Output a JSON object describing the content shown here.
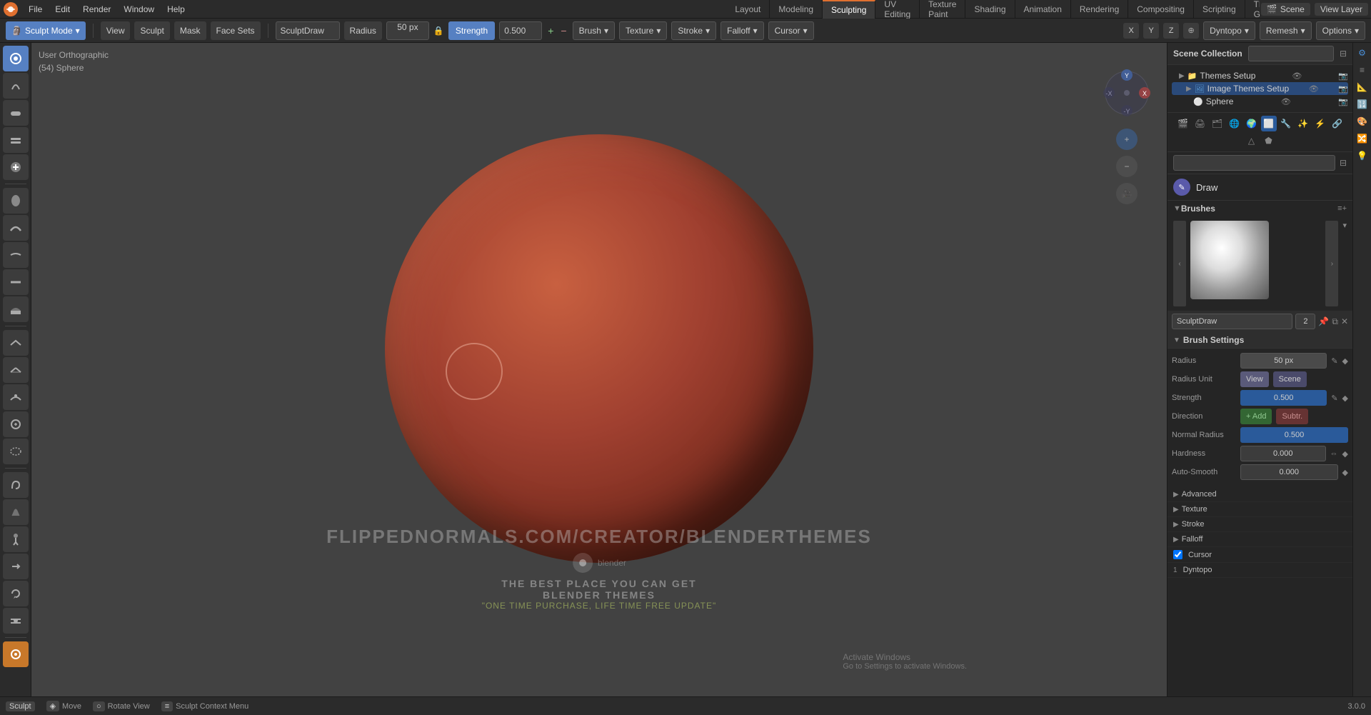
{
  "app": {
    "title": "Blender",
    "version": "3.0.0"
  },
  "top_menu": {
    "items": [
      "File",
      "Edit",
      "Render",
      "Window",
      "Help"
    ],
    "tabs": [
      "Layout",
      "Modeling",
      "Sculpting",
      "UV Editing",
      "Texture Paint",
      "Shading",
      "Animation",
      "Rendering",
      "Compositing",
      "Scripting",
      "Themes Generator"
    ],
    "active_tab": "Sculpting",
    "plus_label": "+",
    "view_layer": "View Layer",
    "scene": "Scene"
  },
  "toolbar": {
    "mode": "Sculpt Mode",
    "view_label": "View",
    "sculpt_label": "Sculpt",
    "mask_label": "Mask",
    "face_sets_label": "Face Sets",
    "brush_name": "SculptDraw",
    "radius_label": "Radius",
    "radius_value": "50 px",
    "strength_label": "Strength",
    "strength_value": "0.500",
    "brush_label": "Brush",
    "texture_label": "Texture",
    "stroke_label": "Stroke",
    "falloff_label": "Falloff",
    "cursor_label": "Cursor",
    "axes": [
      "X",
      "Y",
      "Z"
    ],
    "dyntopo_label": "Dyntopo",
    "remesh_label": "Remesh",
    "options_label": "Options"
  },
  "viewport": {
    "view_info": "User Orthographic",
    "object_info": "(54) Sphere",
    "watermark_url": "FLIPPEDNORMALS.COM/CREATOR/BLENDERTHEMES",
    "watermark_line1": "THE BEST PLACE YOU CAN GET",
    "watermark_line2": "BLENDER THEMES",
    "watermark_tagline": "\"ONE TIME PURCHASE, LIFE TIME FREE UPDATE\""
  },
  "outliner": {
    "title": "Scene Collection",
    "search_placeholder": "",
    "items": [
      {
        "label": "Themes Setup",
        "icon": "📁",
        "level": 0,
        "has_eye": true
      },
      {
        "label": "Image Themes Setup",
        "icon": "🖼",
        "level": 1,
        "selected": true,
        "has_eye": true
      },
      {
        "label": "Sphere",
        "icon": "⚪",
        "level": 2,
        "has_eye": true
      }
    ]
  },
  "properties": {
    "draw_label": "Draw",
    "brushes_title": "Brushes",
    "brush_name": "SculptDraw",
    "brush_num": "2",
    "brush_settings_title": "Brush Settings",
    "radius_label": "Radius",
    "radius_value": "50 px",
    "radius_unit_label": "Radius Unit",
    "radius_unit_view": "View",
    "radius_unit_scene": "Scene",
    "strength_label": "Strength",
    "strength_value": "0.500",
    "direction_label": "Direction",
    "direction_add": "Add",
    "direction_sub": "Subtr.",
    "normal_radius_label": "Normal Radius",
    "normal_radius_value": "0.500",
    "hardness_label": "Hardness",
    "hardness_value": "0.000",
    "auto_smooth_label": "Auto-Smooth",
    "auto_smooth_value": "0.000",
    "sections": [
      {
        "label": "Advanced",
        "expanded": false
      },
      {
        "label": "Texture",
        "expanded": false
      },
      {
        "label": "Stroke",
        "expanded": false
      },
      {
        "label": "Falloff",
        "expanded": false
      },
      {
        "label": "Cursor",
        "checked": true
      },
      {
        "label": "Dyntopo",
        "expanded": false
      }
    ]
  },
  "status_bar": {
    "items": [
      {
        "key": "Sculpt",
        "desc": ""
      },
      {
        "key": "Move",
        "icon": "◈"
      },
      {
        "key": "Rotate View",
        "icon": "○"
      },
      {
        "key": "Sculpt Context Menu",
        "icon": "≡"
      }
    ],
    "version": "3.0.0",
    "activate_windows": "Activate Windows",
    "go_to_settings": "Go to Settings to activate Windows."
  },
  "colors": {
    "accent": "#4a90d9",
    "sculpting_accent": "#e07030",
    "bg_dark": "#1e1e1e",
    "bg_panel": "#252525",
    "bg_toolbar": "#2b2b2b",
    "sphere_gradient_center": "#c86040",
    "sphere_gradient_edge": "#3d1008"
  }
}
